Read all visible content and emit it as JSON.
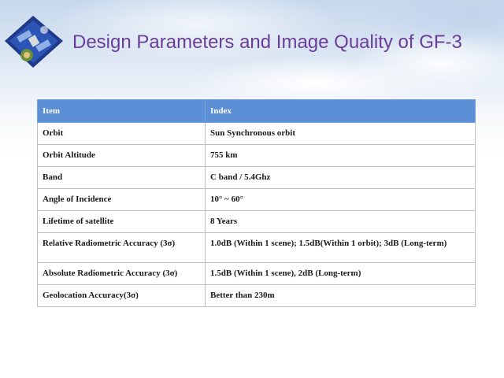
{
  "header": {
    "title": "Design Parameters and  Image Quality of GF-3"
  },
  "table": {
    "columns": [
      "Item",
      "Index"
    ],
    "rows": [
      {
        "item": "Orbit",
        "index": "Sun Synchronous orbit"
      },
      {
        "item": "Orbit Altitude",
        "index": "755 km"
      },
      {
        "item": "Band",
        "index": "C band / 5.4Ghz"
      },
      {
        "item": "Angle of Incidence",
        "index": "10° ~ 60°"
      },
      {
        "item": "Lifetime of satellite",
        "index": "8 Years"
      },
      {
        "item": "Relative Radiometric Accuracy (3σ)",
        "index": "1.0dB (Within 1 scene); 1.5dB(Within 1 orbit);  3dB (Long-term)"
      },
      {
        "item": "Absolute Radiometric Accuracy (3σ)",
        "index": "1.5dB (Within 1 scene), 2dB (Long-term)"
      },
      {
        "item": "Geolocation Accuracy(3σ)",
        "index": "Better than 230m"
      }
    ]
  },
  "colors": {
    "title": "#6a3d9a",
    "header_bg": "#5b8fd6",
    "logo_blue": "#1f3a8a"
  },
  "icons": {
    "logo": "satellite-logo-icon"
  }
}
